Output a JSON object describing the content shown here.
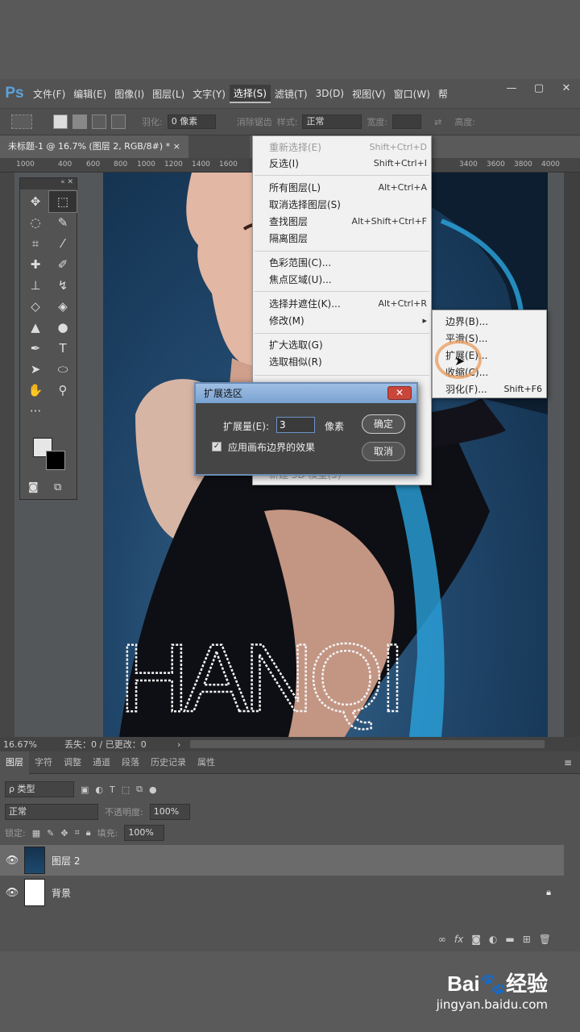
{
  "app": {
    "logo": "Ps"
  },
  "menubar": {
    "items": [
      "文件(F)",
      "编辑(E)",
      "图像(I)",
      "图层(L)",
      "文字(Y)",
      "选择(S)",
      "滤镜(T)",
      "3D(D)",
      "视图(V)",
      "窗口(W)",
      "帮"
    ],
    "active_index": 5
  },
  "window_controls": {
    "minimize": "—",
    "maximize": "▢",
    "close": "✕"
  },
  "options": {
    "feather_label": "羽化:",
    "feather_value": "0 像素",
    "antialias_label": "消除锯齿",
    "style_label": "样式:",
    "style_value": "正常",
    "width_label": "宽度:",
    "height_label": "高度:"
  },
  "document_tab": {
    "title": "未标题-1 @ 16.7% (图层 2, RGB/8#) *",
    "close": "×"
  },
  "ruler": {
    "ticks": [
      "1000",
      "400",
      "600",
      "800",
      "1000",
      "1200",
      "1400",
      "1600",
      "3400",
      "3600",
      "3800",
      "4000"
    ]
  },
  "status": {
    "zoom": "16.67%",
    "info": "丢失：0 / 已更改：0"
  },
  "artwork_text": "HANQI",
  "select_menu": {
    "items": [
      {
        "label": "重新选择(E)",
        "shortcut": "Shift+Ctrl+D",
        "disabled": true
      },
      {
        "label": "反选(I)",
        "shortcut": "Shift+Ctrl+I"
      },
      {
        "label": "所有图层(L)",
        "shortcut": "Alt+Ctrl+A"
      },
      {
        "label": "取消选择图层(S)",
        "shortcut": ""
      },
      {
        "label": "查找图层",
        "shortcut": "Alt+Shift+Ctrl+F"
      },
      {
        "label": "隔离图层",
        "shortcut": ""
      },
      {
        "label": "色彩范围(C)...",
        "shortcut": ""
      },
      {
        "label": "焦点区域(U)...",
        "shortcut": ""
      },
      {
        "label": "选择并遮住(K)...",
        "shortcut": "Alt+Ctrl+R"
      },
      {
        "label": "修改(M)",
        "shortcut": "▸"
      },
      {
        "label": "扩大选取(G)",
        "shortcut": ""
      },
      {
        "label": "选取相似(R)",
        "shortcut": ""
      }
    ],
    "bottom_partial": "新建 3D 模型(3)"
  },
  "modify_submenu": {
    "items": [
      {
        "label": "边界(B)...",
        "shortcut": ""
      },
      {
        "label": "平滑(S)...",
        "shortcut": ""
      },
      {
        "label": "扩展(E)...",
        "shortcut": ""
      },
      {
        "label": "收缩(C)...",
        "shortcut": ""
      },
      {
        "label": "羽化(F)...",
        "shortcut": "Shift+F6"
      }
    ]
  },
  "expand_dialog": {
    "title": "扩展选区",
    "close": "✕",
    "amount_label": "扩展量(E):",
    "amount_value": "3",
    "unit": "像素",
    "checkbox_label": "应用画布边界的效果",
    "checked": true,
    "ok": "确定",
    "cancel": "取消"
  },
  "layers_panel": {
    "tabs": [
      "图层",
      "字符",
      "调整",
      "通道",
      "段落",
      "历史记录",
      "属性"
    ],
    "filter_label": "ρ 类型",
    "blend_mode": "正常",
    "opacity_label": "不透明度:",
    "opacity_value": "100%",
    "lock_label": "锁定:",
    "fill_label": "填充:",
    "fill_value": "100%",
    "layers": [
      {
        "name": "图层 2",
        "selected": true
      },
      {
        "name": "背景",
        "locked": true
      }
    ],
    "footer_icons": [
      "link-icon",
      "fx-icon",
      "mask-icon",
      "adjustment-icon",
      "folder-icon",
      "new-layer-icon",
      "trash-icon"
    ]
  },
  "watermark": {
    "logo": "Bai🐾经验",
    "url": "jingyan.baidu.com"
  }
}
